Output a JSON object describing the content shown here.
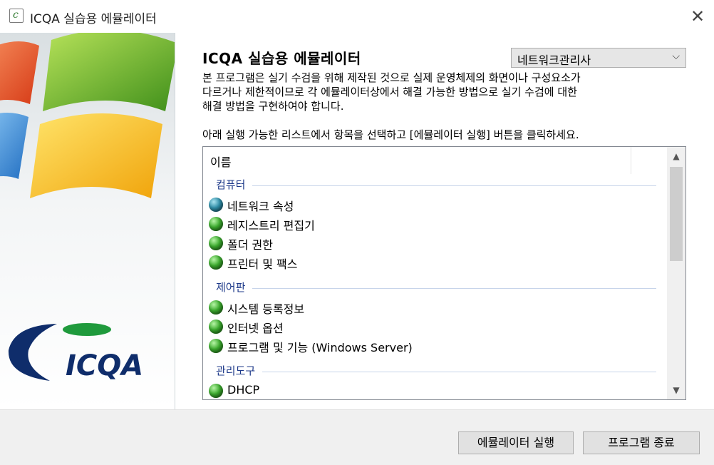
{
  "window": {
    "title": "ICQA 실습용 에뮬레이터",
    "app_icon_letter": "c",
    "close_icon": "close-icon"
  },
  "banner": {
    "logo_text": "ICQA",
    "colors": {
      "red": "#e8542c",
      "green": "#6fb32a",
      "blue": "#3d8fd8",
      "yellow": "#f6c11b",
      "navy": "#0f2d6b"
    }
  },
  "main": {
    "heading": "ICQA 실습용 에뮬레이터",
    "role_select": {
      "value": "네트워크관리사"
    },
    "description_lines": [
      "본 프로그램은 실기 수검을 위해 제작된 것으로 실제 운영체제의 화면이나 구성요소가",
      "다르거나 제한적이므로 각 에뮬레이터상에서 해결 가능한 방법으로 실기 수검에 대한",
      "해결 방법을 구현하여야 합니다."
    ],
    "instruction": "아래 실행 가능한 리스트에서 항목을 선택하고 [에뮬레이터 실행] 버튼을 클릭하세요."
  },
  "list": {
    "header": "이름",
    "groups": [
      {
        "label": "컴퓨터",
        "items": [
          {
            "label": "네트워크 속성",
            "icon": "blue"
          },
          {
            "label": "레지스트리 편집기",
            "icon": "green"
          },
          {
            "label": "폴더 권한",
            "icon": "green"
          },
          {
            "label": "프린터 및 팩스",
            "icon": "green"
          }
        ]
      },
      {
        "label": "제어판",
        "items": [
          {
            "label": "시스템 등록정보",
            "icon": "green"
          },
          {
            "label": "인터넷 옵션",
            "icon": "green"
          },
          {
            "label": "프로그램 및 기능 (Windows Server)",
            "icon": "green"
          }
        ]
      },
      {
        "label": "관리도구",
        "items": [
          {
            "label": "DHCP",
            "icon": "green"
          }
        ]
      }
    ]
  },
  "footer": {
    "run_button": "에뮬레이터 실행",
    "exit_button": "프로그램 종료"
  }
}
